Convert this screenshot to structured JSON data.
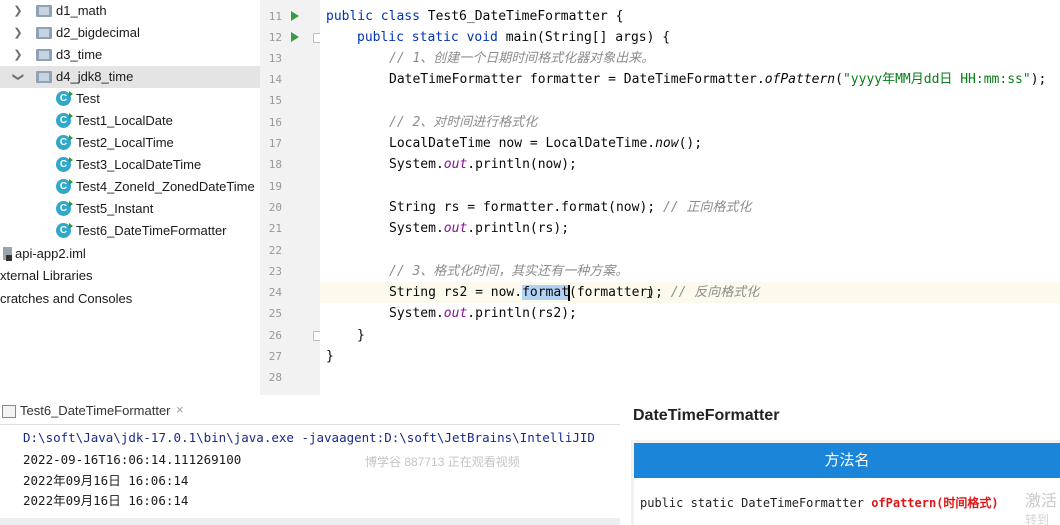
{
  "project_tree": {
    "items": [
      {
        "label": "d1_math",
        "kind": "folder",
        "expanded": false
      },
      {
        "label": "d2_bigdecimal",
        "kind": "folder",
        "expanded": false
      },
      {
        "label": "d3_time",
        "kind": "folder",
        "expanded": false
      },
      {
        "label": "d4_jdk8_time",
        "kind": "folder",
        "expanded": true,
        "selected": true
      },
      {
        "label": "Test",
        "kind": "class"
      },
      {
        "label": "Test1_LocalDate",
        "kind": "class"
      },
      {
        "label": "Test2_LocalTime",
        "kind": "class"
      },
      {
        "label": "Test3_LocalDateTime",
        "kind": "class"
      },
      {
        "label": "Test4_ZoneId_ZonedDateTime",
        "kind": "class"
      },
      {
        "label": "Test5_Instant",
        "kind": "class"
      },
      {
        "label": "Test6_DateTimeFormatter",
        "kind": "class"
      },
      {
        "label": "api-app2.iml",
        "kind": "iml"
      },
      {
        "label": "xternal Libraries",
        "kind": "text"
      },
      {
        "label": "cratches and Consoles",
        "kind": "text"
      }
    ],
    "class_icon_glyph": "C"
  },
  "editor": {
    "line_numbers": [
      "11",
      "12",
      "13",
      "14",
      "15",
      "16",
      "17",
      "18",
      "19",
      "20",
      "21",
      "22",
      "23",
      "24",
      "25",
      "26",
      "27",
      "28"
    ],
    "current_line": "24",
    "lines": {
      "l11": {
        "kw": "public class",
        "rest": " Test6_DateTimeFormatter {"
      },
      "l12": {
        "kw1": "public static void",
        "rest": " main(String[] args) {"
      },
      "l13": {
        "comment": "// 1、创建一个日期时间格式化器对象出来。"
      },
      "l14": {
        "a": "DateTimeFormatter formatter = DateTimeFormatter.",
        "method": "ofPattern",
        "b": "(",
        "str": "\"yyyy年MM月dd日 HH:mm:ss\"",
        "c": ");"
      },
      "l16": {
        "comment": "// 2、对时间进行格式化"
      },
      "l17": {
        "a": "LocalDateTime now = LocalDateTime.",
        "method": "now",
        "b": "();"
      },
      "l18": {
        "a": "System.",
        "field": "out",
        "b": ".println(now);"
      },
      "l20": {
        "a": "String rs = formatter.format(now); ",
        "comment": "// 正向格式化"
      },
      "l21": {
        "a": "System.",
        "field": "out",
        "b": ".println(rs);"
      },
      "l23": {
        "comment": "// 3、格式化时间，其实还有一种方案。"
      },
      "l24": {
        "a": "String rs2 = now.",
        "sel": "format",
        "b": "(formatter); ",
        "comment": "// 反向格式化"
      },
      "l25": {
        "a": "System.",
        "field": "out",
        "b": ".println(rs2);"
      },
      "l26": {
        "a": "}"
      },
      "l27": {
        "a": "}"
      }
    },
    "mouse_cursor_glyph": "I"
  },
  "run_panel": {
    "tab_label": "Test6_DateTimeFormatter",
    "close_glyph": "×",
    "console_lines": [
      "D:\\soft\\Java\\jdk-17.0.1\\bin\\java.exe -javaagent:D:\\soft\\JetBrains\\IntelliJID",
      "2022-09-16T16:06:14.111269100",
      "2022年09月16日 16:06:14",
      "2022年09月16日 16:06:14"
    ],
    "watermark": "博学谷 887713 正在观看视频"
  },
  "card": {
    "title": "DateTimeFormatter",
    "header": "方法名",
    "signature_prefix": "public static DateTimeFormatter ",
    "method_name": "ofPattern(时间格式)",
    "side_text": "激活",
    "side_text2": "转到"
  },
  "colors": {
    "keyword": "#0033b3",
    "comment": "#8c8c8c",
    "string": "#067d17",
    "field": "#871094",
    "card_header": "#1b86d9",
    "card_method": "#e01515",
    "run_gutter": "#3a9b43"
  }
}
